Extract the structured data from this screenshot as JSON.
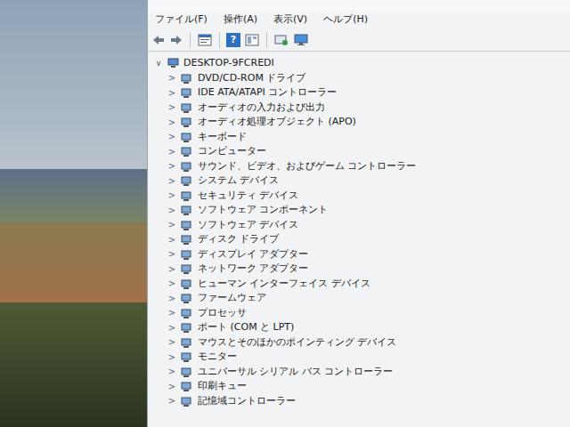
{
  "menu": [
    {
      "label": "ファイル(F)"
    },
    {
      "label": "操作(A)"
    },
    {
      "label": "表示(V)"
    },
    {
      "label": "ヘルプ(H)"
    }
  ],
  "toolbar": {
    "help_glyph": "?"
  },
  "tree": {
    "root": {
      "label": "DESKTOP-9FCREDI",
      "toggle": "∨",
      "expanded": true
    },
    "collapsed_toggle": ">",
    "items": [
      {
        "label": "DVD/CD-ROM ドライブ",
        "expanded": false
      },
      {
        "label": "IDE ATA/ATAPI コントローラー",
        "expanded": false
      },
      {
        "label": "オーディオの入力および出力",
        "expanded": false
      },
      {
        "label": "オーディオ処理オブジェクト (APO)",
        "expanded": false
      },
      {
        "label": "キーボード",
        "expanded": false
      },
      {
        "label": "コンピューター",
        "expanded": false
      },
      {
        "label": "サウンド、ビデオ、およびゲーム コントローラー",
        "expanded": false
      },
      {
        "label": "システム デバイス",
        "expanded": false
      },
      {
        "label": "セキュリティ デバイス",
        "expanded": false
      },
      {
        "label": "ソフトウェア コンポーネント",
        "expanded": false
      },
      {
        "label": "ソフトウェア デバイス",
        "expanded": false
      },
      {
        "label": "ディスク ドライブ",
        "expanded": false
      },
      {
        "label": "ディスプレイ アダプター",
        "expanded": false
      },
      {
        "label": "ネットワーク アダプター",
        "expanded": false
      },
      {
        "label": "ヒューマン インターフェイス デバイス",
        "expanded": false
      },
      {
        "label": "ファームウェア",
        "expanded": false
      },
      {
        "label": "プロセッサ",
        "expanded": false
      },
      {
        "label": "ポート (COM と LPT)",
        "expanded": false
      },
      {
        "label": "マウスとそのほかのポインティング デバイス",
        "expanded": false
      },
      {
        "label": "モニター",
        "expanded": false
      },
      {
        "label": "ユニバーサル シリアル バス コントローラー",
        "expanded": false
      },
      {
        "label": "印刷キュー",
        "expanded": false
      },
      {
        "label": "記憶域コントローラー",
        "expanded": false
      }
    ]
  }
}
